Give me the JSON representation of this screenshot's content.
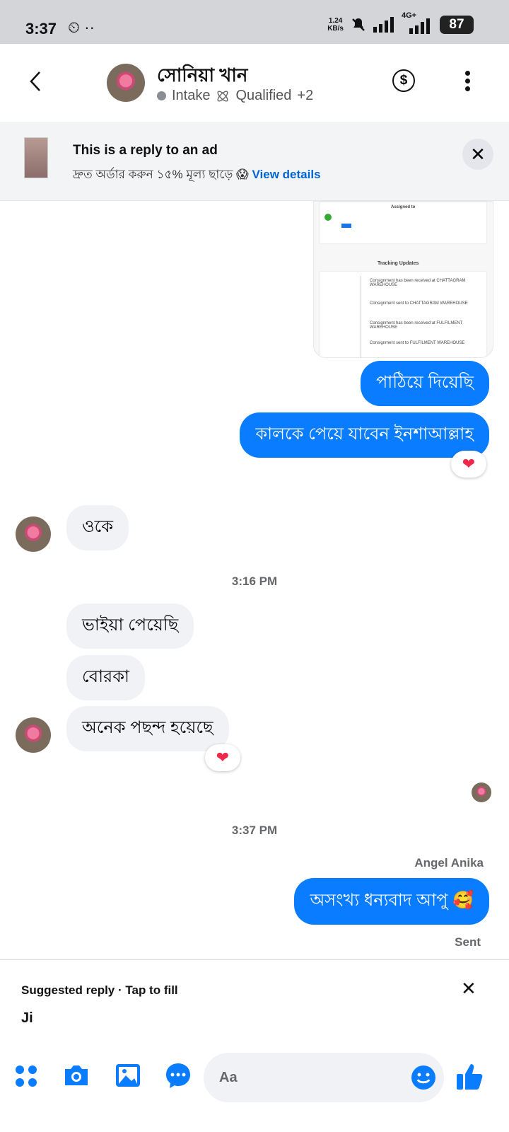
{
  "status_bar": {
    "time": "3:37",
    "left_icons": "⏲ ··",
    "speed_top": "1.24",
    "speed_bottom": "KB/s",
    "network": "4G+",
    "battery": "87"
  },
  "header": {
    "name": "সোনিয়া খান",
    "stage": "Intake",
    "label": "Qualified",
    "more": "+2"
  },
  "ad_banner": {
    "title": "This is a reply to an ad",
    "subtitle": "দ্রুত অর্ডার করুন ১৫% মূল্য ছাড়ে 😱",
    "link": "View details"
  },
  "shared_screenshot": {
    "assigned_to": "Assigned to",
    "tracking_title": "Tracking Updates",
    "entries": [
      "Consignment has been received at CHATTAGRAM WAREHOUSE",
      "Consignment sent to CHATTAGRAM WAREHOUSE",
      "Consignment has been received at FULFILMENT WAREHOUSE",
      "Consignment sent to FULFILMENT WAREHOUSE"
    ]
  },
  "messages": [
    {
      "direction": "out",
      "text": "পাঠিয়ে দিয়েছি"
    },
    {
      "direction": "out",
      "text": "কালকে পেয়ে যাবেন ইনশাআল্লাহ",
      "reaction": "❤"
    },
    {
      "direction": "in",
      "text": "ওকে"
    },
    {
      "direction": "in",
      "text": "ভাইয়া পেয়েছি"
    },
    {
      "direction": "in",
      "text": "বোরকা"
    },
    {
      "direction": "in",
      "text": "অনেক পছন্দ হয়েছে",
      "reaction": "❤"
    },
    {
      "direction": "out",
      "text": "অসংখ্য ধন্যবাদ আপু 🥰"
    }
  ],
  "time_separators": [
    "3:16 PM",
    "3:37 PM"
  ],
  "sender_label": "Angel Anika",
  "sent_label": "Sent",
  "suggested_reply": {
    "title": "Suggested reply · Tap to fill",
    "value": "Ji"
  },
  "composer": {
    "placeholder": "Aa"
  },
  "colors": {
    "accent": "#0a7cff",
    "incoming_bubble": "#f0f2f5",
    "heart": "#f0284a"
  },
  "icons": [
    "apps-icon",
    "camera-icon",
    "gallery-icon",
    "chat-bubble-icon",
    "emoji-icon",
    "thumbs-up-icon"
  ]
}
